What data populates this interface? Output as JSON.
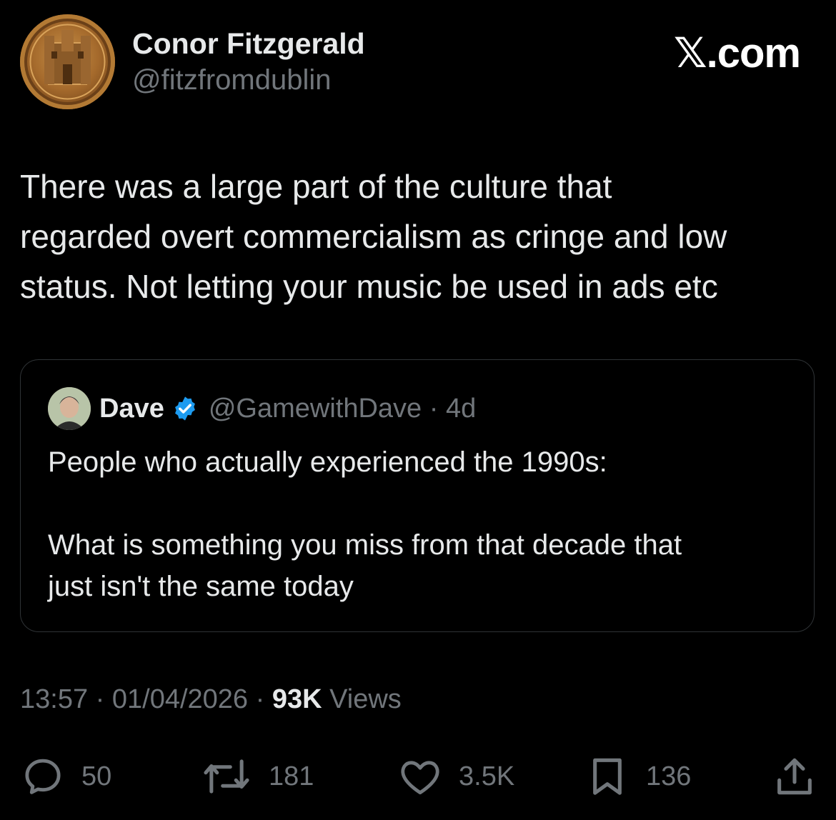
{
  "author": {
    "name": "Conor Fitzgerald",
    "handle": "@fitzfromdublin"
  },
  "brand": "𝕏.com",
  "tweet": {
    "lines": [
      "There was a large part of the culture that",
      "regarded overt commercialism as cringe and low",
      "status. Not letting your music be used in ads etc"
    ]
  },
  "quoted": {
    "name": "Dave",
    "handle_time": "@GamewithDave · 4d",
    "text": "People who actually experienced the 1990s:\n\nWhat is something you miss from that decade that\njust isn't the same today"
  },
  "meta": {
    "prefix": "13:57 · 01/04/2026 · ",
    "views_count": "93K",
    "views_label": " Views"
  },
  "actions": {
    "replies": "50",
    "reposts": "181",
    "likes": "3.5K",
    "bookmarks": "136"
  },
  "icons": {
    "reply": "reply-icon",
    "repost": "repost-icon",
    "like": "heart-icon",
    "bookmark": "bookmark-icon",
    "share": "share-icon",
    "verified": "verified-badge-icon"
  },
  "colors": {
    "background": "#000000",
    "text": "#e7e9ea",
    "secondary": "#71767b",
    "verified": "#1d9bf0",
    "border": "#2f3336"
  }
}
